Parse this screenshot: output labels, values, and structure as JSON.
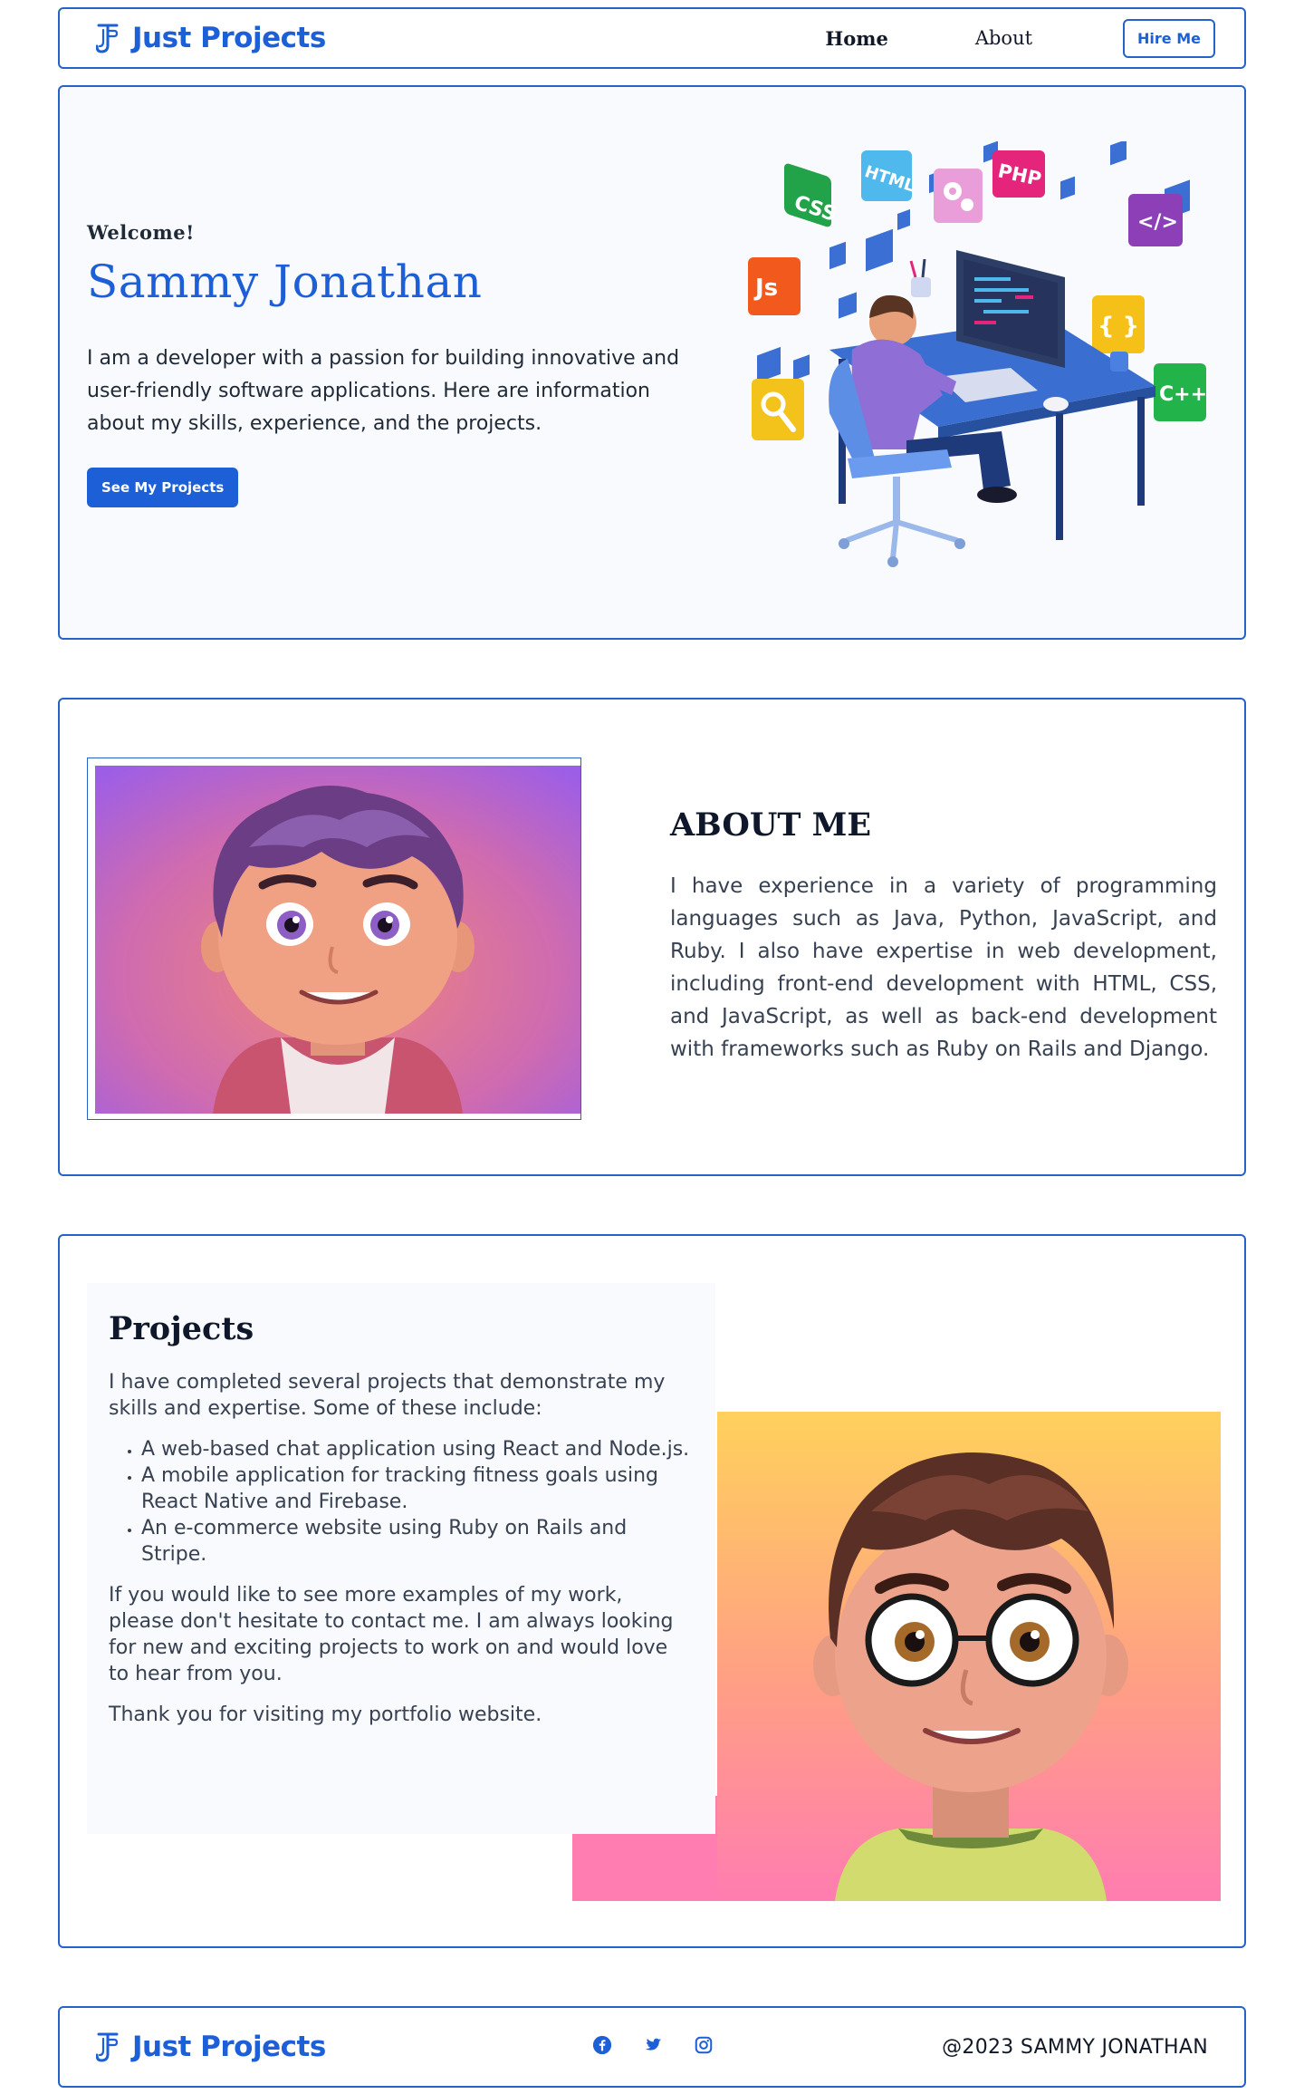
{
  "brand": {
    "name": "Just Projects",
    "color": "#1d5fd6"
  },
  "nav": {
    "home": "Home",
    "about": "About",
    "hire": "Hire Me"
  },
  "hero": {
    "welcome": "Welcome!",
    "name": "Sammy Jonathan",
    "description": "I am a developer with a passion for building innovative and user-friendly software applications. Here are information about my skills, experience, and the projects.",
    "cta": "See My Projects",
    "illustration_tiles": {
      "css": "CSS",
      "html": "HTML",
      "php": "PHP",
      "code": "</>",
      "js": "Js",
      "braces": "{ }",
      "cpp": "C++"
    }
  },
  "about": {
    "title": "ABOUT ME",
    "text": "I have experience in a variety of programming languages such as Java, Python, JavaScript, and Ruby. I also have expertise in web development, including front-end development with HTML, CSS, and JavaScript, as well as back-end development with frameworks such as Ruby on Rails and Django."
  },
  "projects": {
    "title": "Projects",
    "intro": "I have completed several projects that demonstrate my skills and expertise. Some of these include:",
    "items": [
      "A web-based chat application using React and Node.js.",
      "A mobile application for tracking fitness goals using React Native and Firebase.",
      "An e-commerce website using Ruby on Rails and Stripe."
    ],
    "contact": "If you would like to see more examples of my work, please don't hesitate to contact me. I am always looking for new and exciting projects to work on and would love to hear from you.",
    "thanks": "Thank you for visiting my portfolio website."
  },
  "footer": {
    "brand": "Just Projects",
    "socials": [
      "facebook-icon",
      "twitter-icon",
      "instagram-icon"
    ],
    "copyright": "@2023 SAMMY JONATHAN"
  }
}
